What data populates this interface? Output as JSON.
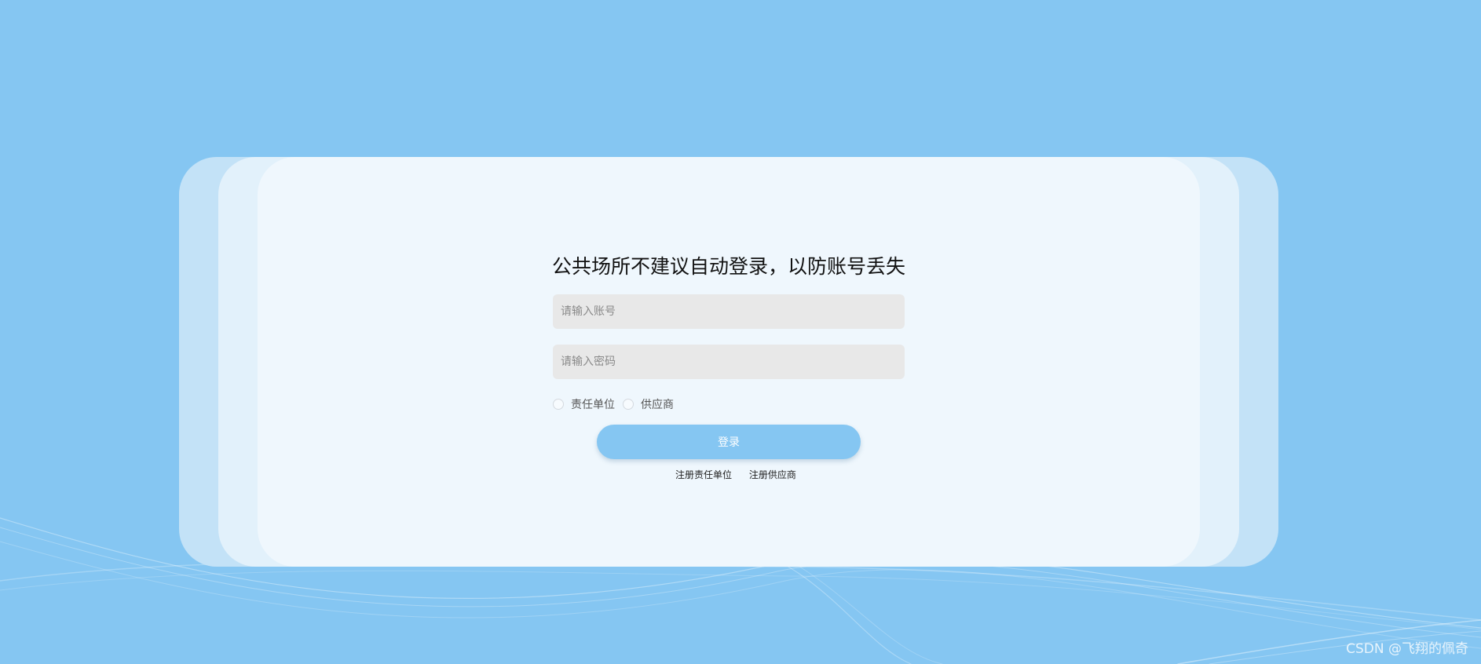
{
  "login": {
    "title": "公共场所不建议自动登录，以防账号丢失",
    "account_placeholder": "请输入账号",
    "password_placeholder": "请输入密码",
    "roles": [
      "责任单位",
      "供应商"
    ],
    "login_button": "登录",
    "register_links": [
      "注册责任单位",
      "注册供应商"
    ]
  },
  "watermark": "CSDN @飞翔的佩奇",
  "colors": {
    "background": "#85c6f2",
    "card": "#eff7fd",
    "input_background": "#e8e8e8",
    "button": "#85c6f2"
  }
}
